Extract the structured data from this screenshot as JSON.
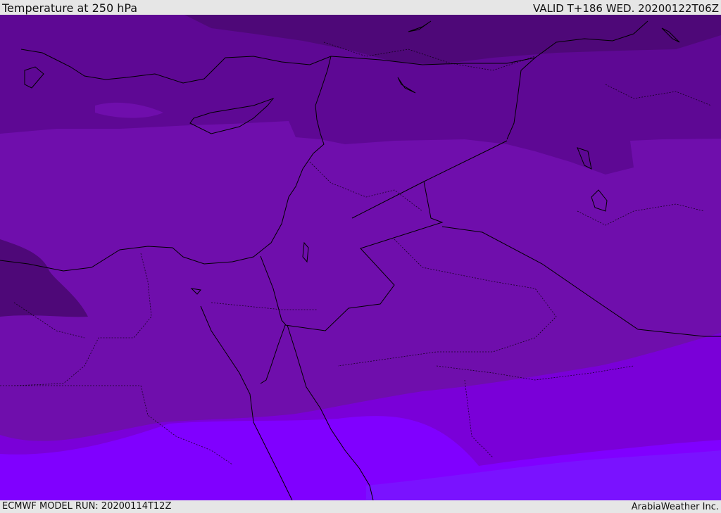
{
  "header": {
    "title": "Temperature at 250 hPa",
    "valid": "VALID T+186 WED. 20200122T06Z"
  },
  "footer": {
    "model_run": "ECMWF MODEL RUN: 20200114T12Z",
    "credit": "ArabiaWeather Inc."
  },
  "map": {
    "colors": {
      "band_darkest": "#4e0878",
      "band_dark": "#5e0894",
      "band_mid": "#6f0eac",
      "band_mid_light": "#7a00d8",
      "band_light": "#8000ff",
      "band_lightest": "#7a12ff",
      "borders": "#000000"
    }
  }
}
